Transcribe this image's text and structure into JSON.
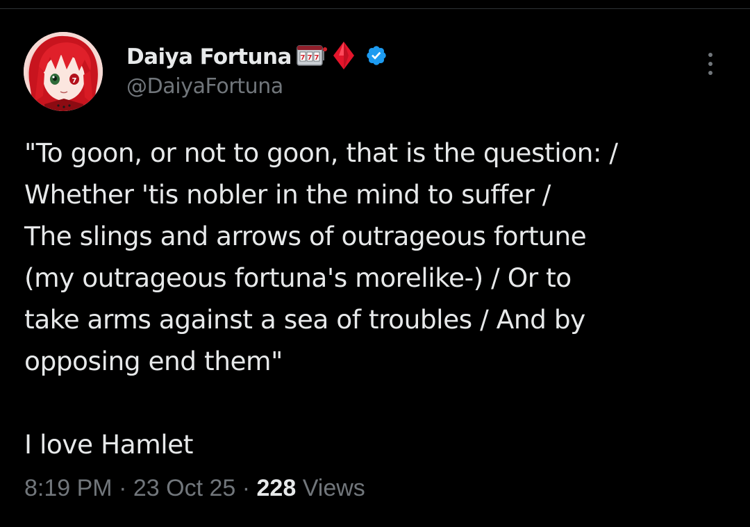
{
  "author": {
    "display_name": "Daiya Fortuna",
    "handle": "@DaiyaFortuna",
    "name_emojis": [
      "slot-machine-icon",
      "red-diamond-icon"
    ],
    "verified": true,
    "verified_color": "#1d9bf0"
  },
  "tweet": {
    "lines": [
      "\"To goon, or not to goon, that is the question: /",
      "Whether 'tis nobler in the mind to suffer /",
      "The slings and arrows of outrageous fortune",
      "(my outrageous fortuna's morelike-) / Or to",
      "take arms against a sea of troubles / And by",
      "opposing end them\"",
      "I love Hamlet"
    ]
  },
  "meta": {
    "time": "8:19 PM",
    "separator": "·",
    "date": "23 Oct 25",
    "views_count": "228",
    "views_label": "Views"
  },
  "colors": {
    "background": "#000000",
    "text_primary": "#e7e9ea",
    "text_secondary": "#71767b",
    "accent": "#1d9bf0"
  }
}
